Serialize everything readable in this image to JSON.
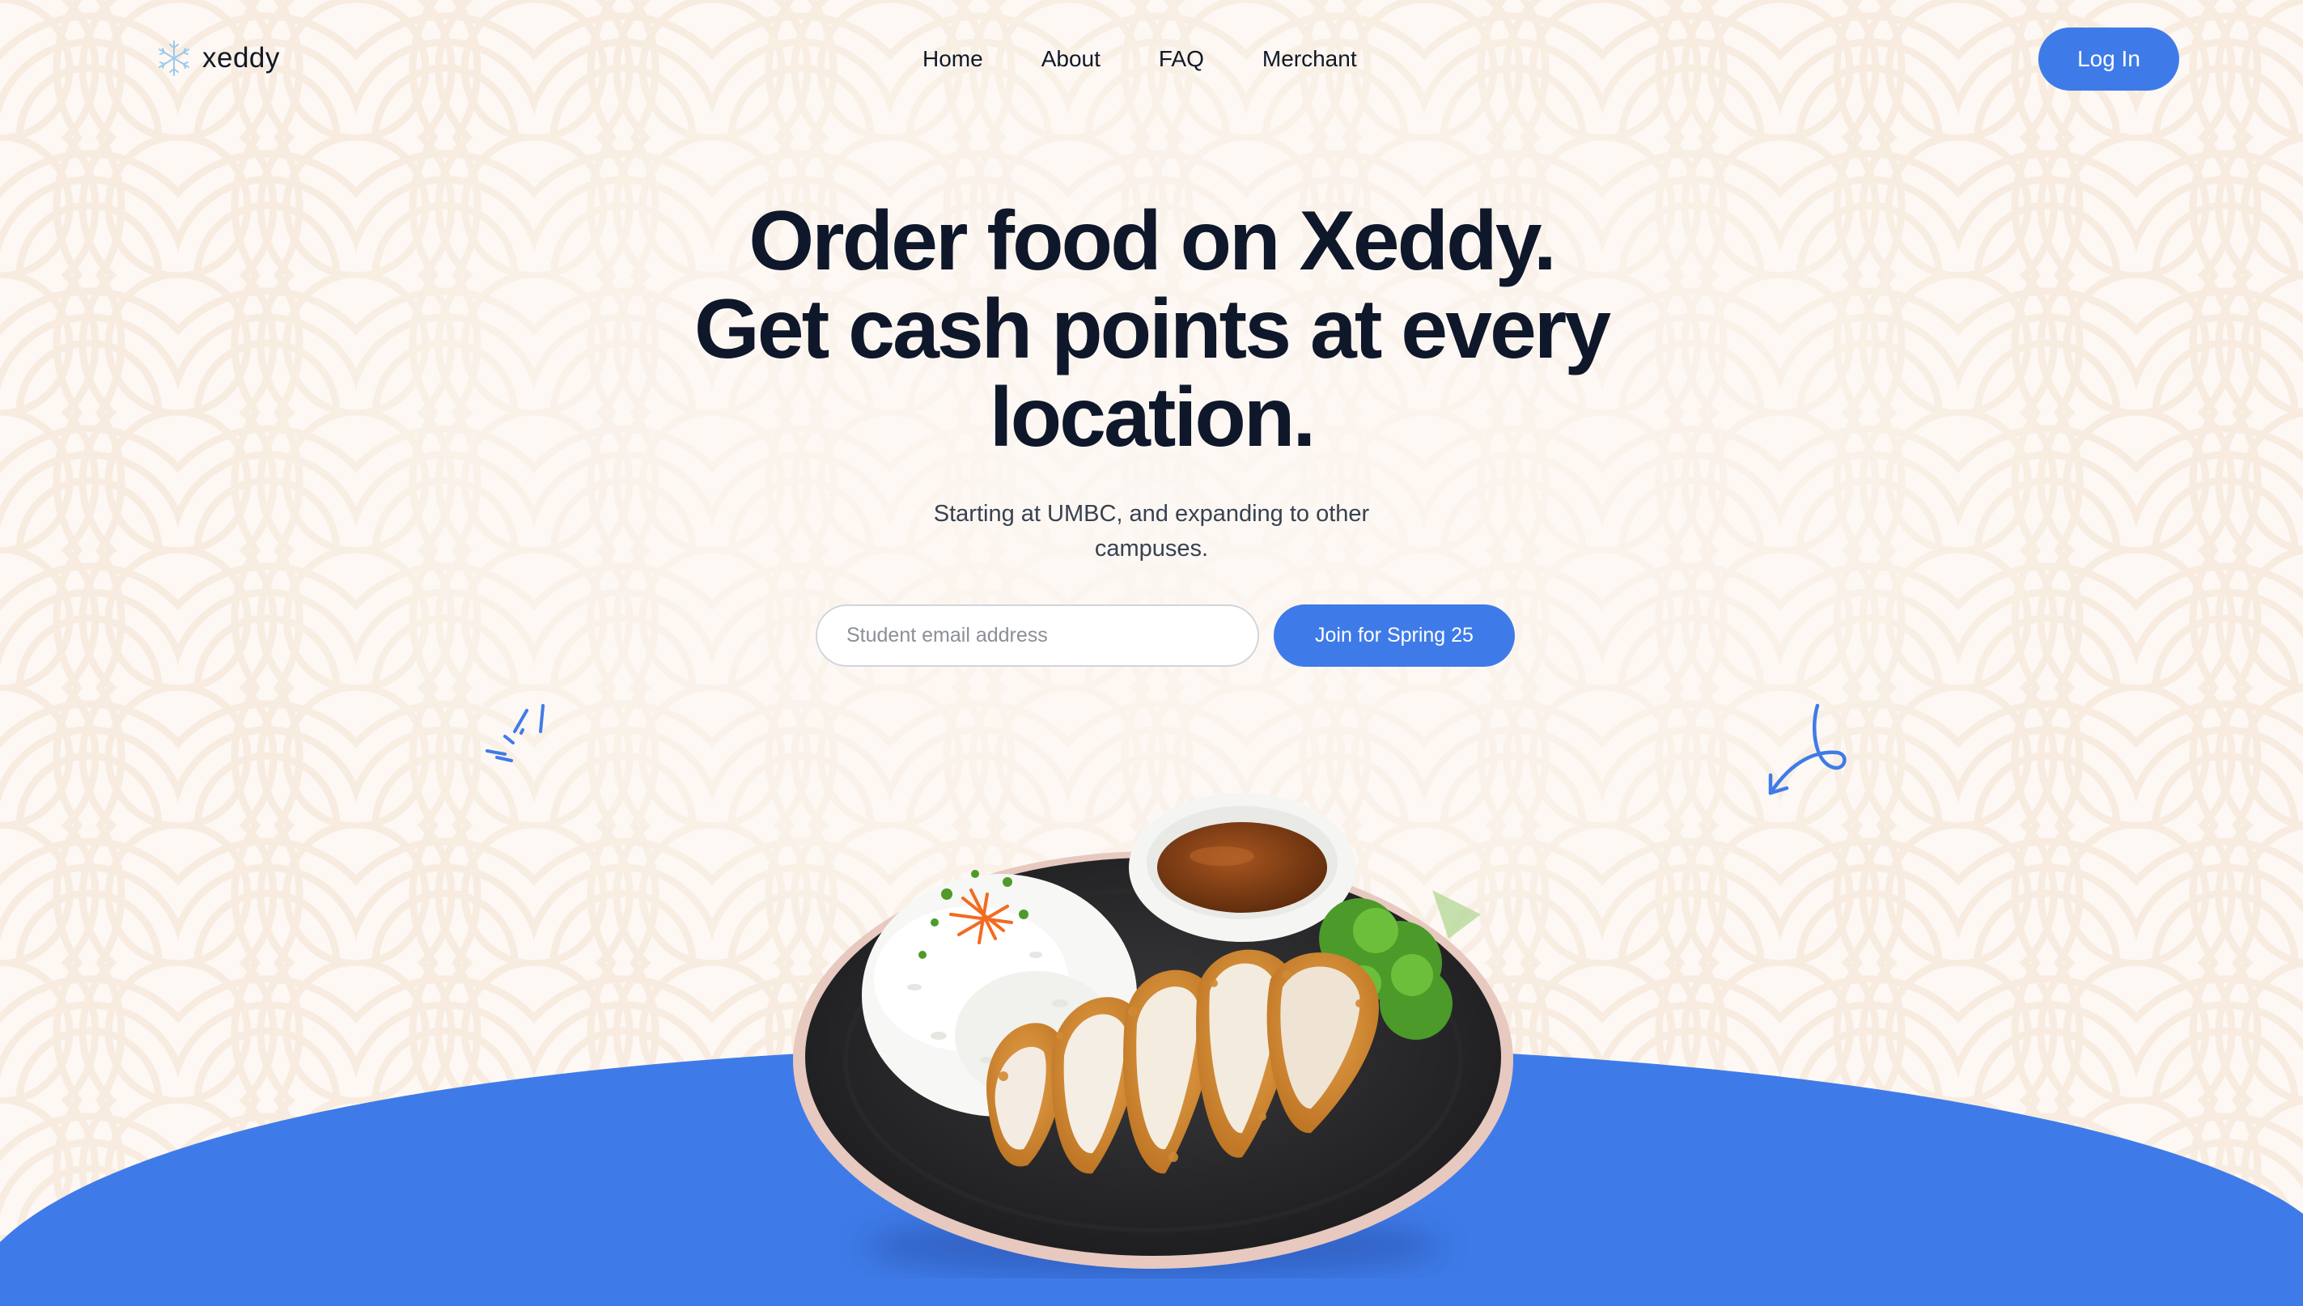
{
  "brand": {
    "name": "xeddy",
    "logo_icon": "snowflake-logo-icon"
  },
  "nav": {
    "links": [
      "Home",
      "About",
      "FAQ",
      "Merchant"
    ],
    "login_label": "Log In"
  },
  "hero": {
    "headline_lines": [
      "Order food on Xeddy.",
      "Get cash points at every",
      "location."
    ],
    "subtitle": "Starting at UMBC, and expanding to other campuses.",
    "email_placeholder": "Student email address",
    "join_label": "Join for Spring 25"
  },
  "decorations": [
    "sparkle-lines-icon",
    "curly-arrow-icon"
  ],
  "image": {
    "description_name": "chicken-katsu-plate"
  },
  "colors": {
    "accent": "#3f7be8",
    "background": "#fdf8f4",
    "pattern": "#f7ebdc",
    "headline": "#0f172a"
  }
}
